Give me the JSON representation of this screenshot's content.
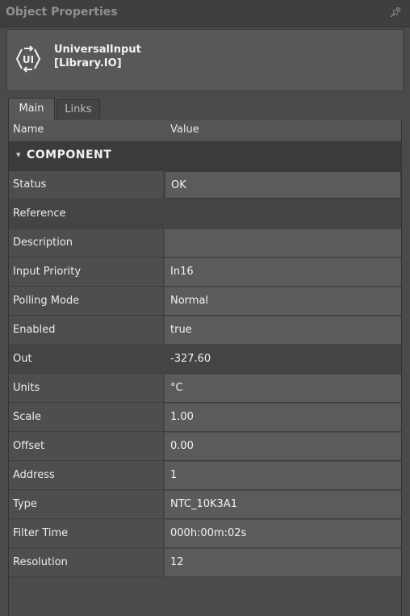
{
  "window": {
    "title": "Object Properties",
    "pin_icon": "pin-icon"
  },
  "object": {
    "icon": "universal-input-icon",
    "icon_text": "UI",
    "name": "UniversalInput",
    "library": "[Library.IO]"
  },
  "tabs": [
    {
      "label": "Main",
      "active": true
    },
    {
      "label": "Links",
      "active": false
    }
  ],
  "grid": {
    "headers": {
      "name": "Name",
      "value": "Value"
    },
    "group": {
      "label": "COMPONENT",
      "expanded": true
    },
    "rows": [
      {
        "name": "Status",
        "value": "OK"
      },
      {
        "name": "Reference",
        "value": ""
      },
      {
        "name": "Description",
        "value": ""
      },
      {
        "name": "Input Priority",
        "value": "In16"
      },
      {
        "name": "Polling Mode",
        "value": "Normal"
      },
      {
        "name": "Enabled",
        "value": "true"
      },
      {
        "name": "Out",
        "value": "-327.60"
      },
      {
        "name": "Units",
        "value": "°C"
      },
      {
        "name": "Scale",
        "value": "1.00"
      },
      {
        "name": "Offset",
        "value": "0.00"
      },
      {
        "name": "Address",
        "value": "1"
      },
      {
        "name": "Type",
        "value": "NTC_10K3A1"
      },
      {
        "name": "Filter Time",
        "value": "000h:00m:02s"
      },
      {
        "name": "Resolution",
        "value": "12"
      }
    ]
  }
}
